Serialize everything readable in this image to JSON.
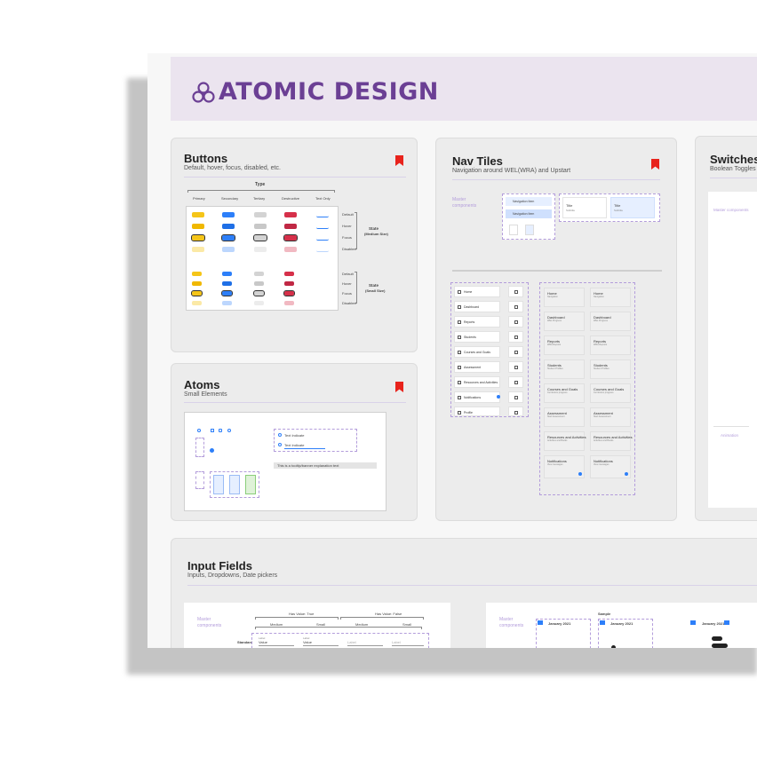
{
  "header": {
    "title": "ATOMIC DESIGN",
    "accent": "#6b3f94",
    "background": "#ebe4ef",
    "logo_icon": "atom-cluster-icon"
  },
  "buttons_card": {
    "title": "Buttons",
    "subtitle": "Default, hover, focus, disabled, etc.",
    "type_label": "Type",
    "columns": [
      "Primary",
      "Secondary",
      "Tertiary",
      "Destructive",
      "Text Only"
    ],
    "state_rows": [
      "Default",
      "Hover",
      "Focus",
      "Disabled"
    ],
    "state_medium": "State",
    "state_medium_sub": "(Medium Size)",
    "state_small": "State",
    "state_small_sub": "(Small Size)",
    "button_text": "Text",
    "colors": {
      "primary": "#f5c518",
      "secondary": "#2d7ff9",
      "tertiary": "#c8c8c8",
      "destructive": "#d6304a",
      "text": "#2d7ff9"
    }
  },
  "nav_tiles_card": {
    "title": "Nav Tiles",
    "subtitle": "Navigation around WEL(WRA) and Upstart",
    "master_label": "Master components",
    "nav_item_label": "Navigation Item",
    "tile_title": "Title",
    "tile_sub": "Subtitle",
    "nav_items": [
      "Home",
      "Dashboard",
      "Reports",
      "Students",
      "Courses and Goals",
      "Assessment",
      "Resources and Activities",
      "Notifications",
      "Profile"
    ],
    "tiles": [
      {
        "title": "Home",
        "sub": "Navigation"
      },
      {
        "title": "Dashboard",
        "sub": "WEL Progress"
      },
      {
        "title": "Reports",
        "sub": "WRA Reports"
      },
      {
        "title": "Students",
        "sub": "Student Profiles"
      },
      {
        "title": "Courses and Goals",
        "sub": "Curriculum progress"
      },
      {
        "title": "Assessment",
        "sub": "Start Assessment"
      },
      {
        "title": "Resources and Activities",
        "sub": "Activities and Books"
      },
      {
        "title": "Notifications",
        "sub": "View messages"
      }
    ]
  },
  "switches_card": {
    "title": "Switches",
    "subtitle": "Boolean Toggles",
    "master_label": "Master components",
    "animation_label": "Animation"
  },
  "atoms_card": {
    "title": "Atoms",
    "subtitle": "Small Elements",
    "text_one": "Text Indicate",
    "text_two": "Text Indicate",
    "banner_text": "This is a tooltip/banner explanation text"
  },
  "input_card": {
    "title": "Input Fields",
    "subtitle": "Inputs, Dropdowns, Date pickers",
    "master_label": "Master components",
    "group_one": "Has Value: True",
    "group_two": "Has Value: False",
    "sizes": [
      "Medium",
      "Small",
      "Medium",
      "Small"
    ],
    "row_label": "Standard",
    "field_value": "Value",
    "field_label": "Label",
    "sample_label": "Sample",
    "month_label": "January 2021"
  }
}
